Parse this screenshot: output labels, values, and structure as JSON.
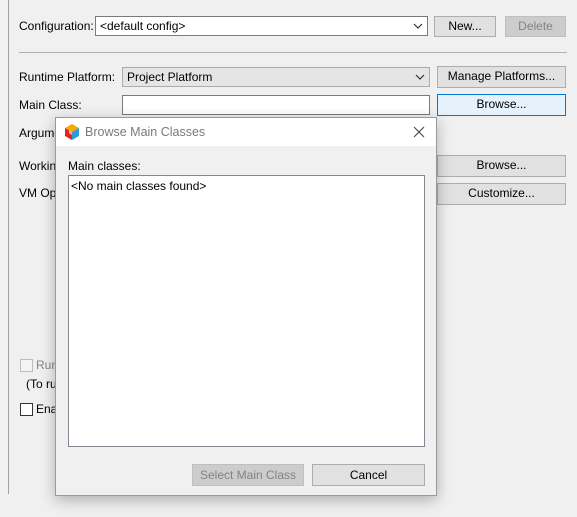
{
  "configuration": {
    "label": "Configuration:",
    "value": "<default config>",
    "new_label": "New...",
    "delete_label": "Delete"
  },
  "runtime": {
    "label": "Runtime Platform:",
    "value": "Project Platform",
    "manage_label": "Manage Platforms..."
  },
  "main_class": {
    "label": "Main Class:",
    "value": "",
    "browse_label": "Browse..."
  },
  "arguments": {
    "label_visible": "Argume"
  },
  "working_dir": {
    "label_visible": "Working",
    "browse_label": "Browse..."
  },
  "vm_options": {
    "label_visible": "VM Opti",
    "customize_label": "Customize..."
  },
  "run_option": {
    "label_visible": "Run",
    "checked": false,
    "enabled": false
  },
  "run_hint": {
    "text_visible": "(To ru"
  },
  "enable_option": {
    "label_visible": "Ena",
    "checked": false
  },
  "dialog": {
    "title": "Browse Main Classes",
    "list_label": "Main classes:",
    "list_items": [
      "<No main classes found>"
    ],
    "select_label": "Select Main Class",
    "cancel_label": "Cancel"
  },
  "colors": {
    "background": "#f0f0f0",
    "dialog_title_text": "#7a7a7a",
    "disabled_text": "#838383",
    "focus_border": "#0078d7",
    "logo_colors": [
      "#e1261c",
      "#f6a800",
      "#2f9bd6",
      "#1b5fa6"
    ]
  }
}
